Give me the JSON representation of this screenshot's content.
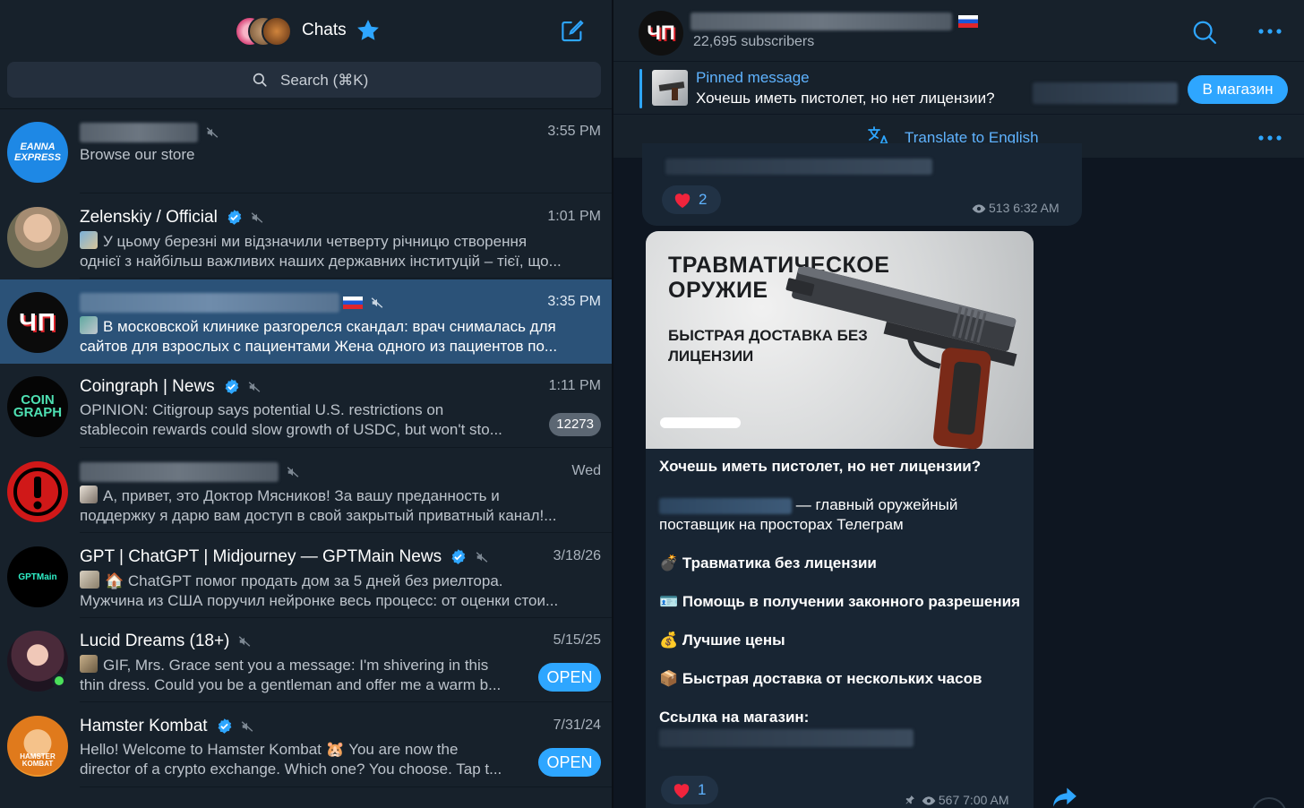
{
  "left": {
    "title": "Chats",
    "search_placeholder": "Search (⌘K)"
  },
  "chats": [
    {
      "name": "",
      "time": "3:55 PM",
      "line1": "Browse our store",
      "line2": "",
      "avatar_text": "EANNA EXPRESS"
    },
    {
      "name": "Zelenskiy / Official",
      "time": "1:01 PM",
      "line1": "У цьому березні ми відзначили четверту річницю створення",
      "line2": "однієї з найбільш важливих наших державних інституцій – тієї, що..."
    },
    {
      "name": "",
      "time": "3:35 PM",
      "line1": "В московской клинике разгорелся скандал: врач снималась для",
      "line2": "сайтов для взрослых с пациентами  Жена одного из пациентов по...",
      "avatar_text": "ЧП"
    },
    {
      "name": "Coingraph | News",
      "time": "1:11 PM",
      "line1": "OPINION: Citigroup says potential U.S. restrictions on",
      "line2": "stablecoin rewards could slow growth of USDC, but won't sto...",
      "badge": "12273",
      "avatar_text": "COIN GRAPH"
    },
    {
      "name": "",
      "time": "Wed",
      "line1": "А, привет, это Доктор Мясников!  За вашу преданность и",
      "line2": "поддержку я дарю вам доступ в свой закрытый приватный канал!..."
    },
    {
      "name": "GPT | ChatGPT | Midjourney — GPTMain News",
      "time": "3/18/26",
      "line1": "🏠 ChatGPT помог продать дом за 5 дней без риелтора.",
      "line2": "Мужчина из США поручил нейронке весь процесс: от оценки стои...",
      "avatar_text": "GPTMain"
    },
    {
      "name": "Lucid Dreams (18+)",
      "time": "5/15/25",
      "line1": "GIF, Mrs. Grace sent you a message: I'm shivering in this",
      "line2": "thin dress. Could you be a gentleman and offer me a warm b...",
      "button": "OPEN"
    },
    {
      "name": "Hamster Kombat",
      "time": "7/31/24",
      "line1": "Hello! Welcome to Hamster Kombat 🐹  You are now the",
      "line2": "director of a crypto exchange. Which one? You choose. Tap t...",
      "button": "OPEN",
      "avatar_text": "HAMSTER KOMBAT"
    }
  ],
  "channel": {
    "avatar_text": "ЧП",
    "subscribers": "22,695 subscribers",
    "pinned_title": "Pinned message",
    "pinned_text": "Хочешь иметь пистолет, но нет лицензии?",
    "shop_button": "В магазин",
    "translate": "Translate to English"
  },
  "messages": {
    "prev": {
      "reaction_count": "2",
      "views": "513",
      "time": "6:32 AM"
    },
    "post": {
      "image_title": "ТРАВМАТИЧЕСКОЕ ОРУЖИЕ",
      "image_sub": "БЫСТРАЯ ДОСТАВКА БЕЗ ЛИЦЕНЗИИ",
      "headline": "Хочешь иметь пистолет, но нет лицензии?",
      "supplier": "— главный оружейный поставщик на просторах Телеграм",
      "b1": "💣 Травматика без лицензии",
      "b2": "🪪 Помощь в получении законного разрешения",
      "b3": "💰 Лучшие цены",
      "b4": "📦 Быстрая доставка от нескольких часов",
      "link_label": "Ссылка на магазин:",
      "reaction_count": "1",
      "views": "567",
      "time": "7:00 AM"
    }
  },
  "colors": {
    "accent": "#2ea6ff",
    "selected": "#2b5278",
    "sidebar": "#17212b",
    "chat_bg": "#0e1621",
    "bubble": "#182533"
  }
}
